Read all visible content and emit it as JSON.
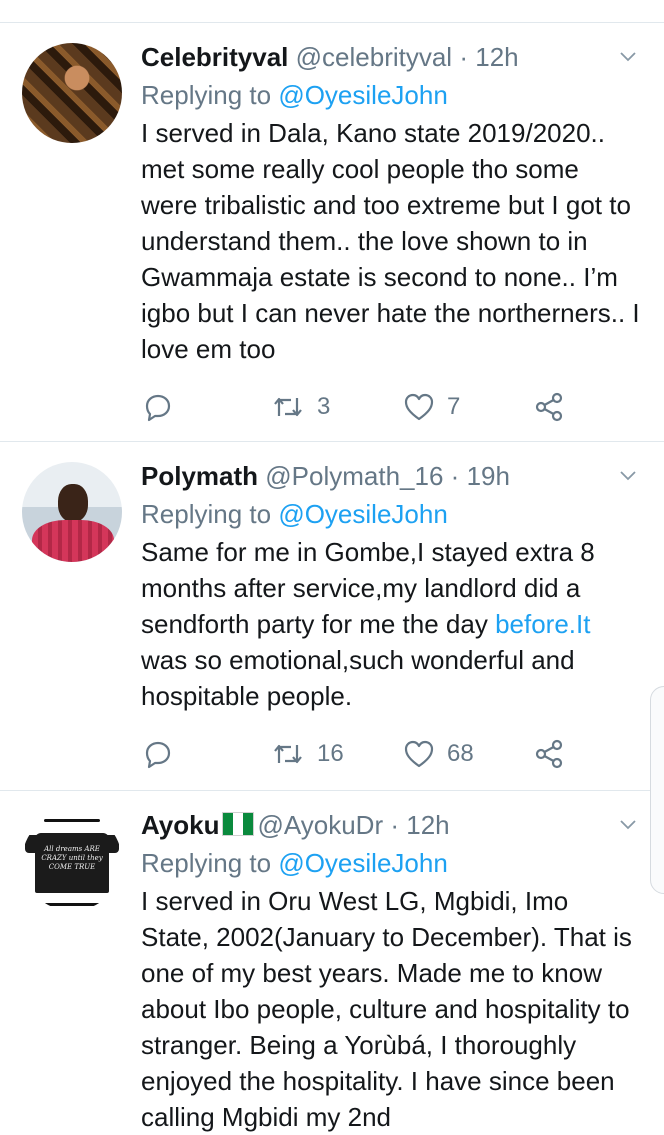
{
  "tweets": [
    {
      "name": "Celebrityval",
      "handle": "@celebrityval",
      "dot": "·",
      "time": "12h",
      "reply_prefix": "Replying to",
      "reply_to": "@OyesileJohn",
      "text": "I served in Dala, Kano state 2019/2020.. met some really cool people tho some were tribalistic and too extreme but I got to understand them.. the love shown to in Gwammaja estate is second to none.. I’m igbo but I can never hate the northerners.. I love em too",
      "retweets": "3",
      "likes": "7"
    },
    {
      "name": "Polymath",
      "handle": "@Polymath_16",
      "dot": "·",
      "time": "19h",
      "reply_prefix": "Replying to",
      "reply_to": "@OyesileJohn",
      "text_before": "Same for me in Gombe,I stayed extra 8 months after service,my landlord did a sendforth party for me the day ",
      "text_link": "before.It",
      "text_after": " was so emotional,such wonderful and hospitable people.",
      "retweets": "16",
      "likes": "68"
    },
    {
      "name": "Ayoku",
      "flag": "Nigeria flag",
      "handle": "@AyokuDr",
      "dot": "·",
      "time": "12h",
      "reply_prefix": "Replying to",
      "reply_to": "@OyesileJohn",
      "text": "I served in Oru West LG, Mgbidi, Imo State, 2002(January to December). That is one of my best years. Made me to know about Ibo people, culture and hospitality to stranger. Being a Yorùbá, I thoroughly enjoyed the hospitality. I have since been calling Mgbidi my 2nd",
      "avatar_text": "All dreams ARE CRAZY until they COME TRUE"
    }
  ],
  "colors": {
    "accent": "#1da1f2",
    "secondary_text": "#657786",
    "primary_text": "#14171a",
    "divider": "#e1e8ed"
  },
  "icons": [
    "reply-icon",
    "retweet-icon",
    "like-icon",
    "share-icon",
    "chevron-down-icon"
  ]
}
